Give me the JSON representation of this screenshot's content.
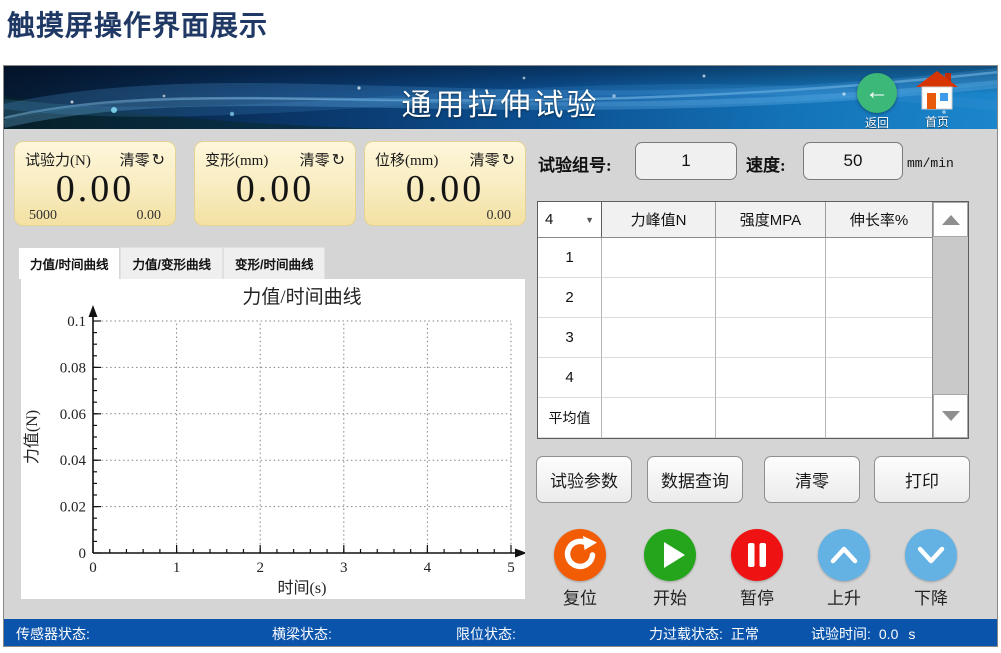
{
  "page_title": "触摸屏操作界面展示",
  "header": {
    "title": "通用拉伸试验",
    "back_label": "返回",
    "home_label": "首页"
  },
  "meters": [
    {
      "label": "试验力(N)",
      "clear_label": "清零",
      "value": "0.00",
      "sub_left": "5000",
      "sub_right": "0.00"
    },
    {
      "label": "变形(mm)",
      "clear_label": "清零",
      "value": "0.00",
      "sub_left": "",
      "sub_right": ""
    },
    {
      "label": "位移(mm)",
      "clear_label": "清零",
      "value": "0.00",
      "sub_left": "",
      "sub_right": "0.00"
    }
  ],
  "tabs": [
    {
      "label": "力值/时间曲线",
      "active": true
    },
    {
      "label": "力值/变形曲线",
      "active": false
    },
    {
      "label": "变形/时间曲线",
      "active": false
    }
  ],
  "chart_data": {
    "type": "line",
    "title": "力值/时间曲线",
    "xlabel": "时间(s)",
    "ylabel": "力值(N)",
    "xlim": [
      0,
      5
    ],
    "ylim": [
      0,
      0.1
    ],
    "x_ticks": [
      0,
      1,
      2,
      3,
      4,
      5
    ],
    "y_ticks": [
      0,
      0.02,
      0.04,
      0.06,
      0.08,
      0.1
    ],
    "y_tick_labels": [
      "0",
      "0.02",
      "0.04",
      "0.06",
      "0.08",
      "0.1"
    ],
    "x_minor_step": 0.2,
    "y_minor_step": 0.005,
    "grid": "dotted",
    "legend": "none",
    "series": []
  },
  "test_group": {
    "label": "试验组号:",
    "value": "1"
  },
  "speed": {
    "label": "速度:",
    "value": "50",
    "unit": "mm/min"
  },
  "results_table": {
    "selector_value": "4",
    "selector_arrow": "▼",
    "columns": [
      "力峰值N",
      "强度MPA",
      "伸长率%"
    ],
    "rows": [
      {
        "index": "1",
        "values": [
          "",
          "",
          ""
        ]
      },
      {
        "index": "2",
        "values": [
          "",
          "",
          ""
        ]
      },
      {
        "index": "3",
        "values": [
          "",
          "",
          ""
        ]
      },
      {
        "index": "4",
        "values": [
          "",
          "",
          ""
        ]
      },
      {
        "index": "平均值",
        "values": [
          "",
          "",
          ""
        ]
      }
    ]
  },
  "action_buttons": [
    {
      "label": "试验参数"
    },
    {
      "label": "数据查询"
    },
    {
      "label": "清零"
    },
    {
      "label": "打印"
    }
  ],
  "control_buttons": [
    {
      "label": "复位",
      "color": "#f25c05",
      "icon": "reset-icon"
    },
    {
      "label": "开始",
      "color": "#24a51c",
      "icon": "play-icon"
    },
    {
      "label": "暂停",
      "color": "#ee1212",
      "icon": "pause-icon"
    },
    {
      "label": "上升",
      "color": "#64b2e4",
      "icon": "chevron-up-icon"
    },
    {
      "label": "下降",
      "color": "#64b2e4",
      "icon": "chevron-down-icon"
    }
  ],
  "status_bar": [
    {
      "label": "传感器状态:",
      "value": ""
    },
    {
      "label": "横梁状态:",
      "value": ""
    },
    {
      "label": "限位状态:",
      "value": ""
    },
    {
      "label": "力过载状态:",
      "value": "正常"
    },
    {
      "label": "试验时间:",
      "value": "0.0",
      "unit": "s"
    }
  ],
  "colors": {
    "status_bar_bg": "#0b54ab",
    "header_base": "#0c5092",
    "meter_bg": "#f8ecc0",
    "back_button": "#3cb878",
    "reset_button": "#f25c05",
    "start_button": "#24a51c",
    "pause_button": "#ee1212",
    "jog_button": "#64b2e4"
  }
}
